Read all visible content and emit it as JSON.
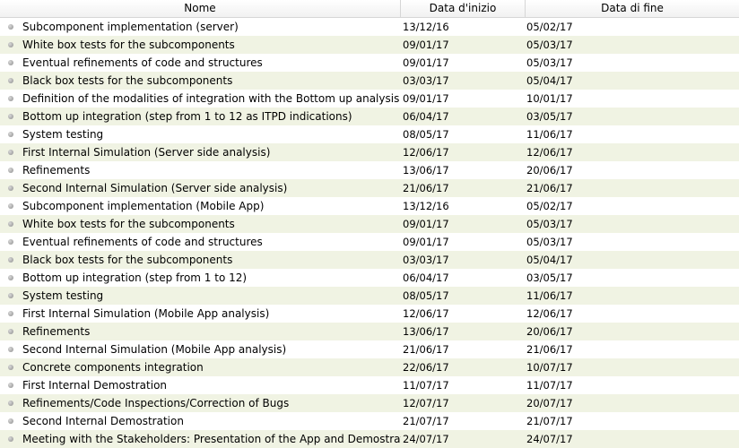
{
  "columns": {
    "name": "Nome",
    "start": "Data d'inizio",
    "end": "Data di fine"
  },
  "rows": [
    {
      "name": "Subcomponent implementation (server)",
      "start": "13/12/16",
      "end": "05/02/17"
    },
    {
      "name": "White box tests for the subcomponents",
      "start": "09/01/17",
      "end": "05/03/17"
    },
    {
      "name": "Eventual refinements of code and structures",
      "start": "09/01/17",
      "end": "05/03/17"
    },
    {
      "name": "Black box tests for the subcomponents",
      "start": "03/03/17",
      "end": "05/04/17"
    },
    {
      "name": "Definition of the modalities of integration with the Bottom up analysis",
      "start": "09/01/17",
      "end": "10/01/17"
    },
    {
      "name": "Bottom up integration (step from 1 to 12 as ITPD indications)",
      "start": "06/04/17",
      "end": "03/05/17"
    },
    {
      "name": "System testing",
      "start": "08/05/17",
      "end": "11/06/17"
    },
    {
      "name": "First Internal Simulation (Server side analysis)",
      "start": "12/06/17",
      "end": "12/06/17"
    },
    {
      "name": "Refinements",
      "start": "13/06/17",
      "end": "20/06/17"
    },
    {
      "name": "Second Internal Simulation (Server side analysis)",
      "start": "21/06/17",
      "end": "21/06/17"
    },
    {
      "name": "Subcomponent implementation (Mobile App)",
      "start": "13/12/16",
      "end": "05/02/17"
    },
    {
      "name": "White box tests for the subcomponents",
      "start": "09/01/17",
      "end": "05/03/17"
    },
    {
      "name": "Eventual refinements of code and structures",
      "start": "09/01/17",
      "end": "05/03/17"
    },
    {
      "name": "Black box tests for the subcomponents",
      "start": "03/03/17",
      "end": "05/04/17"
    },
    {
      "name": "Bottom up integration (step from 1 to 12)",
      "start": "06/04/17",
      "end": "03/05/17"
    },
    {
      "name": "System testing",
      "start": "08/05/17",
      "end": "11/06/17"
    },
    {
      "name": "First Internal Simulation (Mobile App analysis)",
      "start": "12/06/17",
      "end": "12/06/17"
    },
    {
      "name": "Refinements",
      "start": "13/06/17",
      "end": "20/06/17"
    },
    {
      "name": "Second Internal Simulation (Mobile App analysis)",
      "start": "21/06/17",
      "end": "21/06/17"
    },
    {
      "name": "Concrete components integration",
      "start": "22/06/17",
      "end": "10/07/17"
    },
    {
      "name": "First Internal Demostration",
      "start": "11/07/17",
      "end": "11/07/17"
    },
    {
      "name": "Refinements/Code Inspections/Correction of Bugs",
      "start": "12/07/17",
      "end": "20/07/17"
    },
    {
      "name": "Second Internal Demostration",
      "start": "21/07/17",
      "end": "21/07/17"
    },
    {
      "name": "Meeting with the Stakeholders: Presentation of the App and Demostrations",
      "start": "24/07/17",
      "end": "24/07/17"
    }
  ],
  "icons": {
    "row_bullet": "task-bullet-icon"
  },
  "colors": {
    "row_alt": "#f0f3e3",
    "row_base": "#ffffff",
    "header_border": "#d6d6d6"
  }
}
